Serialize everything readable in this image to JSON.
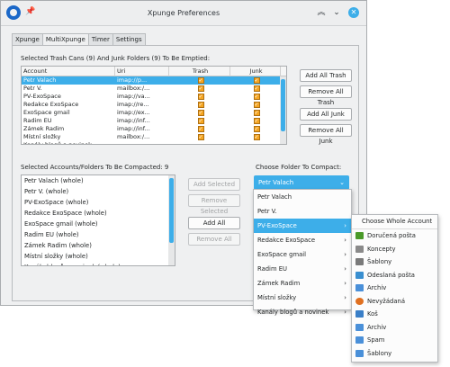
{
  "window": {
    "title": "Xpunge Preferences"
  },
  "tabs": [
    {
      "label": "Xpunge"
    },
    {
      "label": "MultiXpunge"
    },
    {
      "label": "Timer"
    },
    {
      "label": "Settings"
    }
  ],
  "trash_section": {
    "heading": "Selected Trash Cans (9) And Junk Folders (9) To Be Emptied:",
    "columns": [
      "Account",
      "Uri",
      "Trash",
      "Junk"
    ],
    "rows": [
      {
        "account": "Petr Valach",
        "uri": "imap://p...",
        "trash": true,
        "junk": true
      },
      {
        "account": "Petr V.",
        "uri": "mailbox:/...",
        "trash": true,
        "junk": true
      },
      {
        "account": "PV-ExoSpace",
        "uri": "imap://va...",
        "trash": true,
        "junk": true
      },
      {
        "account": "Redakce ExoSpace",
        "uri": "imap://re...",
        "trash": true,
        "junk": true
      },
      {
        "account": "ExoSpace gmail",
        "uri": "imap://ex...",
        "trash": true,
        "junk": true
      },
      {
        "account": "Radim EU",
        "uri": "imap://inf...",
        "trash": true,
        "junk": true
      },
      {
        "account": "Zámek Radim",
        "uri": "imap://inf...",
        "trash": true,
        "junk": true
      },
      {
        "account": "Místní složky",
        "uri": "mailbox:/...",
        "trash": true,
        "junk": true
      },
      {
        "account": "Kanály blogů a novinek",
        "uri": "",
        "trash": false,
        "junk": false
      }
    ],
    "buttons": {
      "add_all_trash": "Add All Trash",
      "remove_all_trash": "Remove All Trash",
      "add_all_junk": "Add All Junk",
      "remove_all_junk": "Remove All Junk"
    }
  },
  "compact_section": {
    "heading": "Selected Accounts/Folders To Be Compacted: 9",
    "items": [
      "Petr Valach (whole)",
      "Petr V. (whole)",
      "PV-ExoSpace (whole)",
      "Redakce ExoSpace (whole)",
      "ExoSpace gmail (whole)",
      "Radim EU (whole)",
      "Zámek Radim (whole)",
      "Místní složky (whole)",
      "Kanály blogů a novinek (whole)"
    ],
    "buttons": {
      "add_selected": "Add Selected",
      "remove_selected": "Remove Selected",
      "add_all": "Add All",
      "remove_all": "Remove All"
    }
  },
  "choose_folder": {
    "heading": "Choose Folder To Compact:",
    "selected": "Petr Valach",
    "menu_items": [
      "Petr Valach",
      "Petr V.",
      "PV-ExoSpace",
      "Redakce ExoSpace",
      "ExoSpace gmail",
      "Radim EU",
      "Zámek Radim",
      "Místní složky",
      "Kanály blogů a novinek"
    ],
    "submenu": {
      "header": "Choose Whole Account",
      "items": [
        {
          "label": "Doručená pošta",
          "icon": "inbox-icon",
          "color": "#4a9a2a"
        },
        {
          "label": "Koncepty",
          "icon": "drafts-icon",
          "color": "#8a8a8a"
        },
        {
          "label": "Šablony",
          "icon": "templates-icon",
          "color": "#7a7a7a"
        },
        {
          "label": "Odeslaná pošta",
          "icon": "sent-icon",
          "color": "#3a8fd0"
        },
        {
          "label": "Archiv",
          "icon": "archive-folder-icon",
          "color": "#4a90d9"
        },
        {
          "label": "Nevyžádaná",
          "icon": "junk-icon",
          "color": "#e07020"
        },
        {
          "label": "Koš",
          "icon": "trash-icon",
          "color": "#3a7fc8"
        },
        {
          "label": "Archiv",
          "icon": "folder-icon",
          "color": "#4a90d9"
        },
        {
          "label": "Spam",
          "icon": "folder-icon",
          "color": "#4a90d9"
        },
        {
          "label": "Šablony",
          "icon": "folder-icon",
          "color": "#4a90d9"
        }
      ]
    }
  },
  "colors": {
    "accent": "#3daee9",
    "checkbox": "#f5a623"
  }
}
